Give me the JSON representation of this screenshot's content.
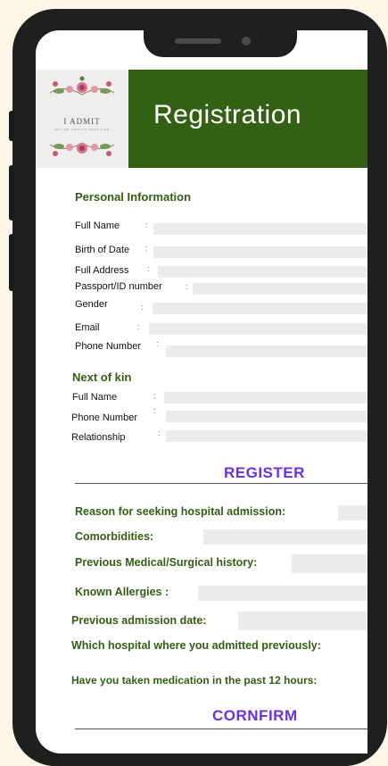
{
  "brand": {
    "logo_text": "I ADMIT",
    "logo_subtext": "ONLINE HEALTH SERVICES"
  },
  "header": {
    "title": "Registration"
  },
  "personal": {
    "heading": "Personal Information",
    "fields": [
      {
        "label": "Full Name"
      },
      {
        "label": "Birth of Date"
      },
      {
        "label": "Full Address"
      },
      {
        "label": "Passport/ID number"
      },
      {
        "label": "Gender"
      },
      {
        "label": "Email"
      },
      {
        "label": "Phone Number"
      }
    ]
  },
  "kin": {
    "heading": "Next of kin",
    "fields": [
      {
        "label": "Full Name"
      },
      {
        "label": "Phone Number"
      },
      {
        "label": "Relationship"
      }
    ]
  },
  "register_button": "REGISTER",
  "medical": {
    "questions": [
      {
        "label": "Reason for seeking hospital admission:"
      },
      {
        "label": "Comorbidities:"
      },
      {
        "label": "Previous Medical/Surgical history:"
      },
      {
        "label": "Known Allergies :"
      },
      {
        "label": "Previous admission date:"
      },
      {
        "label": "Which hospital where you admitted previously:"
      },
      {
        "label": "Have you taken medication in the past 12 hours:"
      }
    ]
  },
  "confirm_button": "CORNFIRM",
  "colors": {
    "primary": "#336114",
    "accent": "#6b32e6",
    "background": "#fdf6e6"
  }
}
